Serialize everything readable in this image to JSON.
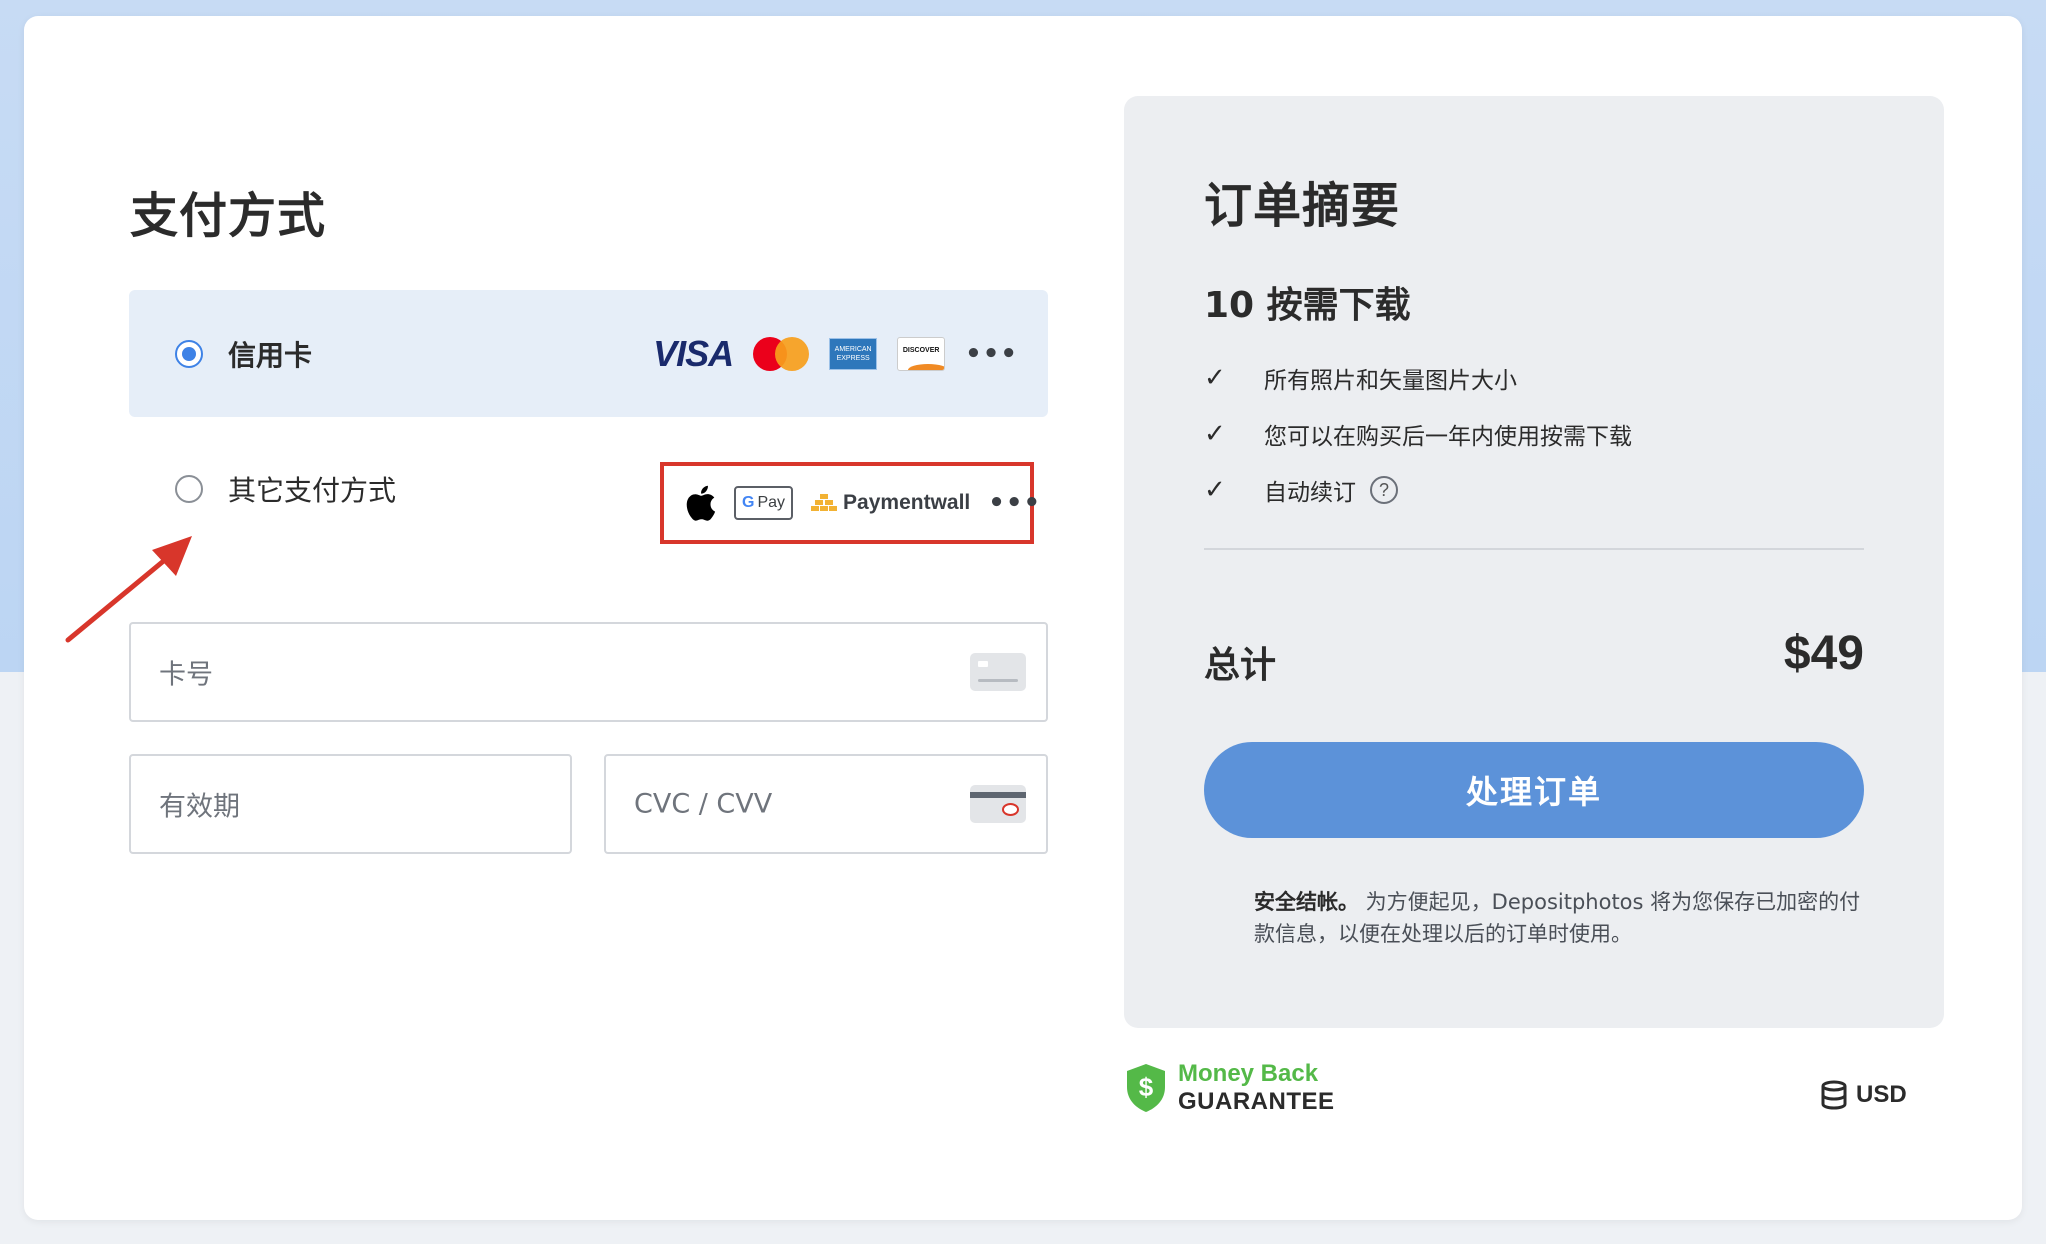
{
  "payment": {
    "title": "支付方式",
    "options": [
      {
        "label": "信用卡",
        "selected": true
      },
      {
        "label": "其它支付方式",
        "selected": false
      }
    ],
    "card_brands": [
      "VISA",
      "Mastercard",
      "American Express",
      "Discover"
    ],
    "amex_text": "AMERICAN EXPRESS",
    "discover_text": "DISCOVER",
    "alt_brands": [
      "Apple Pay",
      "Google Pay",
      "Paymentwall"
    ],
    "gpay_text": "Pay",
    "paymentwall_text": "Paymentwall",
    "more": "•••"
  },
  "fields": {
    "card_number_placeholder": "卡号",
    "expiry_placeholder": "有效期",
    "cvc_placeholder": "CVC / CVV"
  },
  "summary": {
    "title": "订单摘要",
    "plan": "10 按需下载",
    "features": [
      "所有照片和矢量图片大小",
      "您可以在购买后一年内使用按需下载",
      "自动续订"
    ],
    "help_symbol": "?",
    "total_label": "总计",
    "total_value": "$49",
    "button": "处理订单",
    "secure_bold": "安全结帐。",
    "secure_text": " 为方便起见，Depositphotos 将为您保存已加密的付款信息，以便在处理以后的订单时使用。"
  },
  "guarantee": {
    "line1": "Money Back",
    "line2": "GUARANTEE",
    "symbol": "$"
  },
  "currency": "USD",
  "colors": {
    "accent_blue": "#3e82e6",
    "button_blue": "#5c92d9",
    "highlight_red": "#d8362b",
    "guarantee_green": "#54b948"
  }
}
